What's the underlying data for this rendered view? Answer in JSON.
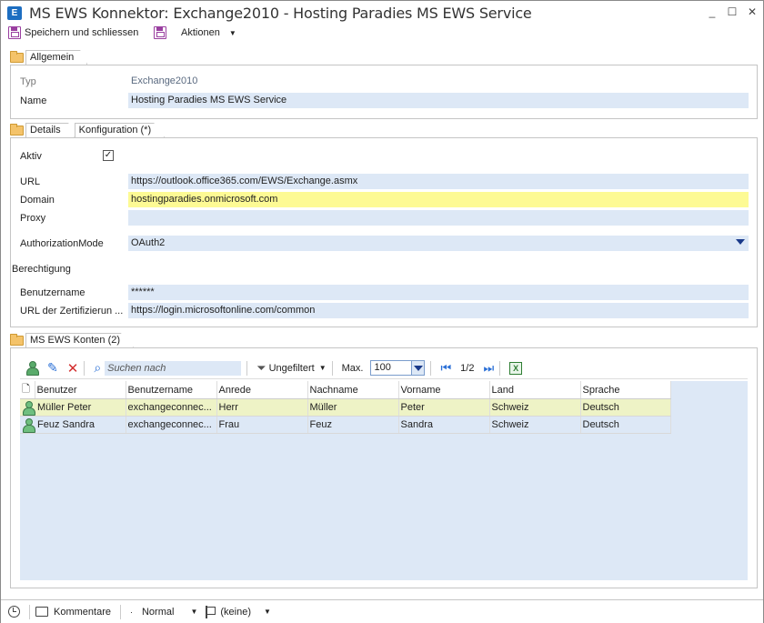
{
  "window": {
    "title": "MS EWS Konnektor: Exchange2010 - Hosting Paradies MS EWS Service"
  },
  "toolbar": {
    "save_close_label": "Speichern und schliessen",
    "actions_label": "Aktionen"
  },
  "general": {
    "tab_label": "Allgemein",
    "type_label": "Typ",
    "type_value": "Exchange2010",
    "name_label": "Name",
    "name_value": "Hosting Paradies MS EWS Service"
  },
  "details": {
    "tab_details": "Details",
    "tab_config": "Konfiguration (*)",
    "active_label": "Aktiv",
    "active_checked": true,
    "active_mark": "✓",
    "url_label": "URL",
    "url_value": "https://outlook.office365.com/EWS/Exchange.asmx",
    "domain_label": "Domain",
    "domain_value": "hostingparadies.onmicrosoft.com",
    "proxy_label": "Proxy",
    "proxy_value": "",
    "auth_label": "AuthorizationMode",
    "auth_value": "OAuth2",
    "permission_label": "Berechtigung",
    "username_label": "Benutzername",
    "username_value": "******",
    "cert_url_label": "URL der Zertifizierun ...",
    "cert_url_value": "https://login.microsoftonline.com/common"
  },
  "accounts": {
    "tab_label": "MS EWS Konten (2)",
    "search_placeholder": "Suchen nach",
    "filter_label": "Ungefiltert",
    "max_label": "Max.",
    "max_value": "100",
    "page_label": "1/2",
    "columns": [
      "Benutzer",
      "Benutzername",
      "Anrede",
      "Nachname",
      "Vorname",
      "Land",
      "Sprache"
    ],
    "rows": [
      [
        "Müller Peter",
        "exchangeconnec...",
        "Herr",
        "Müller",
        "Peter",
        "Schweiz",
        "Deutsch"
      ],
      [
        "Feuz Sandra",
        "exchangeconnec...",
        "Frau",
        "Feuz",
        "Sandra",
        "Schweiz",
        "Deutsch"
      ]
    ]
  },
  "statusbar": {
    "comments_label": "Kommentare",
    "priority_label": "Normal",
    "flag_label": "(keine)"
  },
  "colors": {
    "field_bg": "#dde8f6",
    "highlight_field": "#fdfa94",
    "selected_row": "#eef3c6"
  }
}
